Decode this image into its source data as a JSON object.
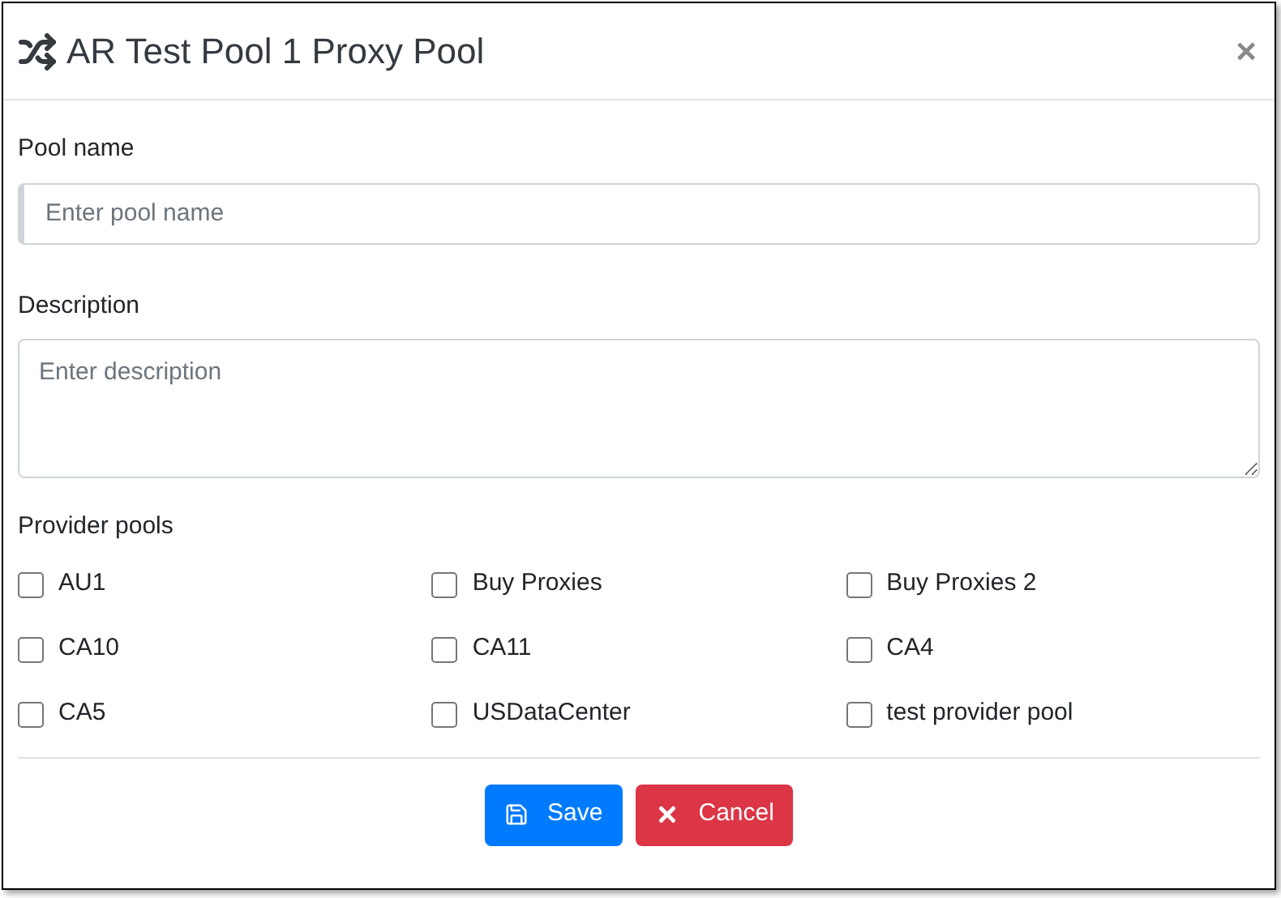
{
  "dialog": {
    "title": "AR Test Pool 1 Proxy Pool",
    "close": "×"
  },
  "pool_name": {
    "label": "Pool name",
    "placeholder": "Enter pool name"
  },
  "description": {
    "label": "Description",
    "placeholder": "Enter description"
  },
  "provider_pools": {
    "label": "Provider pools",
    "items": [
      {
        "label": "AU1",
        "checked": false
      },
      {
        "label": "Buy Proxies",
        "checked": false
      },
      {
        "label": "Buy Proxies 2",
        "checked": false
      },
      {
        "label": "CA10",
        "checked": false
      },
      {
        "label": "CA11",
        "checked": false
      },
      {
        "label": "CA4",
        "checked": false
      },
      {
        "label": "CA5",
        "checked": false
      },
      {
        "label": "USDataCenter",
        "checked": false
      },
      {
        "label": "test provider pool",
        "checked": false
      }
    ]
  },
  "buttons": [
    {
      "kind": "save",
      "label": "Save"
    },
    {
      "kind": "cancel",
      "label": "Cancel"
    }
  ]
}
